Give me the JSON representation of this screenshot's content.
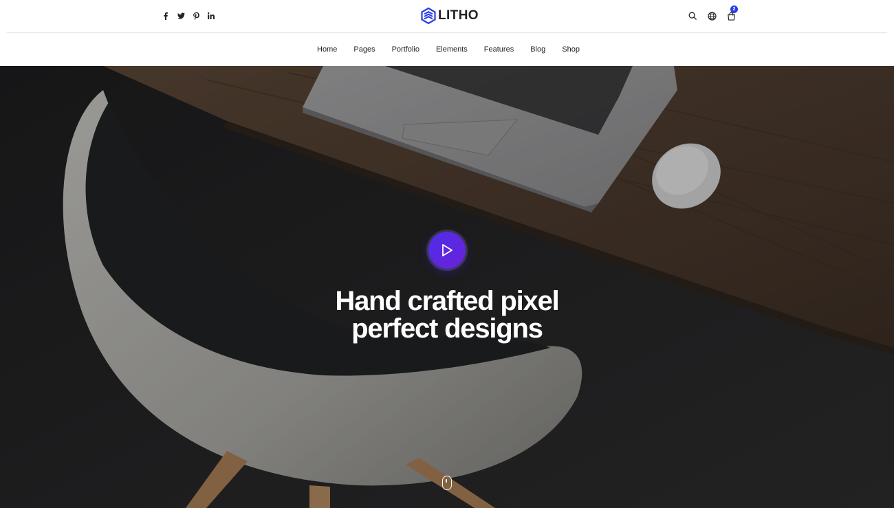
{
  "brand": {
    "name": "LITHO",
    "accent": "#2a3ce8"
  },
  "social": [
    {
      "name": "facebook-icon"
    },
    {
      "name": "twitter-icon"
    },
    {
      "name": "pinterest-icon"
    },
    {
      "name": "linkedin-icon"
    }
  ],
  "header_tools": {
    "cart_count": "2"
  },
  "nav": {
    "items": [
      {
        "label": "Home"
      },
      {
        "label": "Pages"
      },
      {
        "label": "Portfolio"
      },
      {
        "label": "Elements"
      },
      {
        "label": "Features"
      },
      {
        "label": "Blog"
      },
      {
        "label": "Shop"
      }
    ]
  },
  "hero": {
    "title_line1": "Hand crafted pixel",
    "title_line2": "perfect designs",
    "play_color": "#5a28e2"
  }
}
